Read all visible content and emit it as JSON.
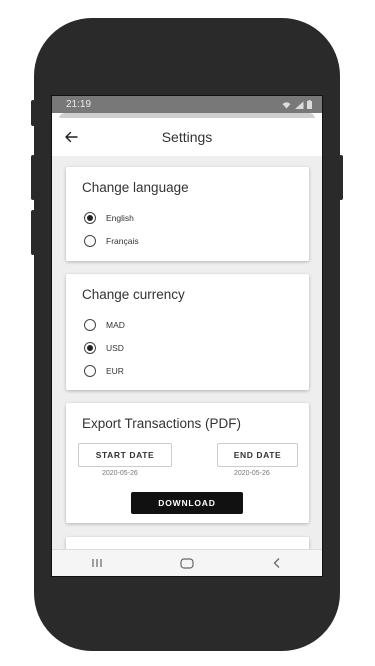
{
  "status": {
    "time": "21:19"
  },
  "appbar": {
    "title": "Settings"
  },
  "language": {
    "title": "Change language",
    "options": [
      {
        "label": "English",
        "selected": true
      },
      {
        "label": "Français",
        "selected": false
      }
    ]
  },
  "currency": {
    "title": "Change currency",
    "options": [
      {
        "label": "MAD",
        "selected": false
      },
      {
        "label": "USD",
        "selected": true
      },
      {
        "label": "EUR",
        "selected": false
      }
    ]
  },
  "export": {
    "title": "Export Transactions (PDF)",
    "start_label": "START DATE",
    "start_value": "2020-05-26",
    "end_label": "END DATE",
    "end_value": "2020-05-26",
    "download_label": "DOWNLOAD"
  },
  "icons": {
    "back": "arrow-left-icon",
    "wifi": "wifi-icon",
    "signal": "signal-icon",
    "battery": "battery-icon",
    "nav_recent": "recent-apps-icon",
    "nav_home": "home-icon",
    "nav_back": "back-chevron-icon"
  }
}
